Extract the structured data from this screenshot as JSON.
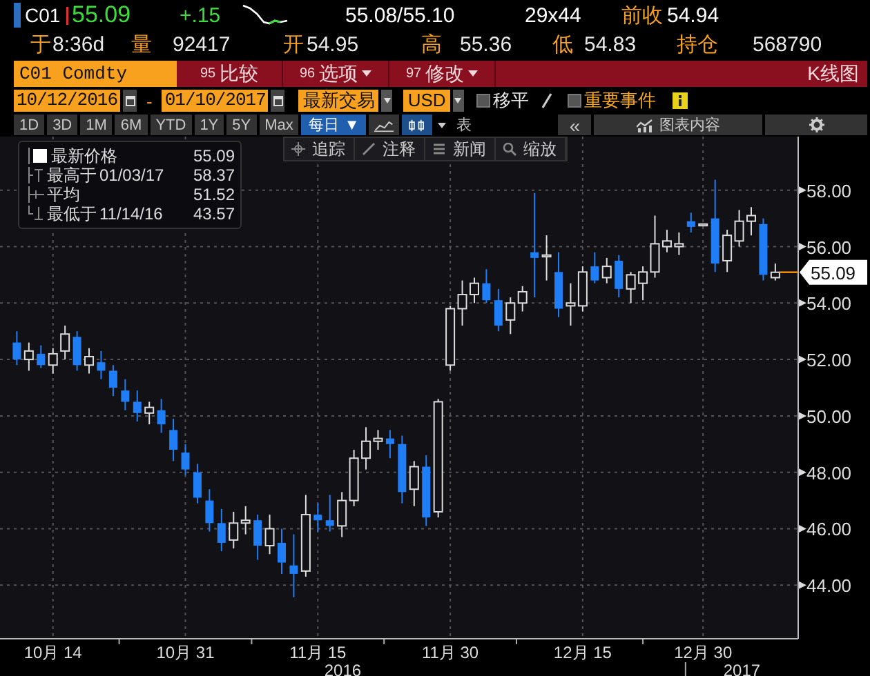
{
  "quote": {
    "ticker": "C01",
    "last": "55.09",
    "change": "+.15",
    "bid_ask": "55.08/55.10",
    "size": "29x44",
    "prev_close": {
      "label": "前收",
      "value": "54.94"
    },
    "stats": [
      {
        "label": "于",
        "value": "8:36d"
      },
      {
        "label": "量",
        "value": "92417"
      },
      {
        "label": "开",
        "value": "54.95"
      },
      {
        "label": "高",
        "value": "55.36"
      },
      {
        "label": "低",
        "value": "54.83"
      },
      {
        "label": "持仓",
        "value": "568790"
      }
    ]
  },
  "command_bar": {
    "security": "C01 Comdty",
    "menus": [
      {
        "number": "95",
        "label": "比较",
        "dropdown": false
      },
      {
        "number": "96",
        "label": "选项",
        "dropdown": true
      },
      {
        "number": "97",
        "label": "修改",
        "dropdown": true
      }
    ],
    "title": "K线图"
  },
  "range_bar": {
    "start_date": "10/12/2016",
    "separator": "-",
    "end_date": "01/10/2017",
    "price_source": "最新交易",
    "currency": "USD",
    "checkboxes": [
      {
        "label": "移平",
        "checked": false,
        "color": "#e8e8e8"
      },
      {
        "label": "重要事件",
        "checked": false,
        "color": "#f5a623"
      }
    ]
  },
  "tool_bar": {
    "periods": [
      {
        "label": "1D",
        "selected": false
      },
      {
        "label": "3D",
        "selected": false
      },
      {
        "label": "1M",
        "selected": false
      },
      {
        "label": "6M",
        "selected": false
      },
      {
        "label": "YTD",
        "selected": false
      },
      {
        "label": "1Y",
        "selected": false
      },
      {
        "label": "5Y",
        "selected": false
      },
      {
        "label": "Max",
        "selected": false
      }
    ],
    "frequency": "每日",
    "frequency_mark": "▼",
    "chart_types": [
      {
        "kind": "line",
        "selected": false
      },
      {
        "kind": "candle",
        "selected": true
      }
    ],
    "table_label": "表",
    "collapse": "«",
    "contents_label": "图表内容"
  },
  "chart": {
    "tools": [
      {
        "kind": "crosshair",
        "label": "追踪"
      },
      {
        "kind": "pencil",
        "label": "注释"
      },
      {
        "kind": "news",
        "label": "新闻"
      },
      {
        "kind": "zoom",
        "label": "缩放"
      }
    ],
    "legend": [
      {
        "kind": "last",
        "label": "最新价格",
        "value": "55.09"
      },
      {
        "kind": "high",
        "label": "最高于",
        "date": "01/03/17",
        "value": "58.37"
      },
      {
        "kind": "average",
        "label": "平均",
        "value": "51.52"
      },
      {
        "kind": "low",
        "label": "最低于",
        "date": "11/14/16",
        "value": "43.57"
      }
    ],
    "last_price_tag": "55.09",
    "year_labels": [
      "2016",
      "2017"
    ],
    "chart_data": {
      "type": "candlestick",
      "grid": true,
      "ylim": [
        42.1,
        59.9
      ],
      "yticks": [
        {
          "value": 44,
          "label": "44.00"
        },
        {
          "value": 46,
          "label": "46.00"
        },
        {
          "value": 48,
          "label": "48.00"
        },
        {
          "value": 50,
          "label": "50.00"
        },
        {
          "value": 52,
          "label": "52.00"
        },
        {
          "value": 54,
          "label": "54.00"
        },
        {
          "value": 56,
          "label": "56.00"
        },
        {
          "value": 58,
          "label": "58.00"
        }
      ],
      "categories": [
        null,
        null,
        null,
        "10月 14",
        null,
        null,
        null,
        null,
        null,
        null,
        null,
        null,
        null,
        null,
        "10月 31",
        null,
        null,
        null,
        null,
        null,
        null,
        null,
        null,
        null,
        null,
        "11月 15",
        null,
        null,
        null,
        null,
        null,
        null,
        null,
        null,
        null,
        null,
        "11月 30",
        null,
        null,
        null,
        null,
        null,
        null,
        null,
        null,
        null,
        null,
        "12月 15",
        null,
        null,
        null,
        null,
        null,
        null,
        null,
        null,
        null,
        "12月 30",
        null,
        null,
        null,
        null,
        null,
        null
      ],
      "ohlc": [
        [
          52.6,
          53.0,
          51.8,
          52.0
        ],
        [
          52.0,
          52.6,
          51.6,
          52.3
        ],
        [
          52.2,
          52.5,
          51.7,
          51.8
        ],
        [
          51.8,
          52.4,
          51.5,
          52.2
        ],
        [
          52.3,
          53.2,
          52.0,
          52.9
        ],
        [
          52.8,
          53.0,
          51.6,
          51.8
        ],
        [
          51.8,
          52.4,
          51.5,
          52.1
        ],
        [
          51.9,
          52.3,
          51.3,
          51.6
        ],
        [
          51.6,
          51.8,
          50.7,
          51.0
        ],
        [
          50.9,
          51.3,
          50.2,
          50.5
        ],
        [
          50.5,
          50.9,
          49.8,
          50.1
        ],
        [
          50.1,
          50.5,
          49.7,
          50.3
        ],
        [
          50.2,
          50.6,
          49.4,
          49.7
        ],
        [
          49.5,
          49.9,
          48.4,
          48.8
        ],
        [
          48.7,
          49.0,
          47.9,
          48.1
        ],
        [
          48.0,
          48.3,
          46.9,
          47.1
        ],
        [
          47.0,
          47.4,
          45.9,
          46.2
        ],
        [
          46.2,
          46.7,
          45.2,
          45.5
        ],
        [
          45.6,
          46.6,
          45.3,
          46.2
        ],
        [
          46.2,
          46.8,
          45.8,
          46.3
        ],
        [
          46.3,
          46.5,
          44.9,
          45.4
        ],
        [
          45.4,
          46.5,
          45.1,
          46.0
        ],
        [
          45.5,
          46.0,
          44.4,
          44.8
        ],
        [
          44.7,
          45.8,
          43.57,
          44.4
        ],
        [
          44.5,
          47.2,
          44.3,
          46.5
        ],
        [
          46.5,
          46.9,
          45.9,
          46.3
        ],
        [
          46.3,
          47.2,
          45.9,
          46.1
        ],
        [
          46.1,
          47.3,
          45.7,
          47.0
        ],
        [
          47.0,
          48.8,
          46.8,
          48.5
        ],
        [
          48.5,
          49.6,
          48.1,
          49.1
        ],
        [
          49.1,
          49.5,
          48.8,
          49.2
        ],
        [
          49.2,
          49.5,
          48.5,
          49.0
        ],
        [
          49.0,
          49.3,
          46.9,
          47.3
        ],
        [
          47.4,
          48.4,
          46.8,
          48.2
        ],
        [
          48.2,
          48.6,
          46.1,
          46.4
        ],
        [
          46.6,
          50.6,
          46.4,
          50.5
        ],
        [
          51.8,
          53.9,
          51.6,
          53.8
        ],
        [
          53.8,
          54.8,
          53.2,
          54.3
        ],
        [
          54.3,
          54.9,
          54.0,
          54.7
        ],
        [
          54.7,
          55.2,
          54.0,
          54.1
        ],
        [
          54.1,
          54.5,
          53.0,
          53.2
        ],
        [
          53.4,
          54.2,
          52.9,
          54.0
        ],
        [
          54.0,
          54.6,
          53.7,
          54.4
        ],
        [
          55.8,
          57.9,
          54.2,
          55.6
        ],
        [
          55.7,
          56.4,
          54.8,
          55.7
        ],
        [
          55.1,
          55.8,
          53.5,
          53.8
        ],
        [
          53.9,
          54.7,
          53.2,
          54.0
        ],
        [
          53.9,
          55.3,
          53.7,
          55.1
        ],
        [
          55.3,
          55.8,
          54.7,
          54.8
        ],
        [
          54.9,
          55.6,
          54.7,
          55.3
        ],
        [
          55.5,
          55.7,
          54.2,
          54.5
        ],
        [
          54.5,
          55.1,
          54.0,
          55.0
        ],
        [
          54.7,
          55.3,
          54.1,
          55.1
        ],
        [
          55.1,
          57.1,
          54.9,
          56.1
        ],
        [
          56.0,
          56.6,
          55.8,
          56.2
        ],
        [
          56.0,
          56.5,
          55.7,
          56.1
        ],
        [
          56.9,
          57.2,
          56.5,
          56.7
        ],
        [
          56.8,
          56.8,
          56.8,
          56.8
        ],
        [
          57.0,
          58.37,
          55.1,
          55.4
        ],
        [
          55.5,
          56.6,
          55.1,
          56.4
        ],
        [
          56.2,
          57.3,
          56.0,
          56.9
        ],
        [
          56.9,
          57.4,
          56.4,
          57.1
        ],
        [
          56.8,
          57.0,
          54.8,
          55.0
        ],
        [
          54.9,
          55.4,
          54.8,
          55.09
        ]
      ]
    }
  }
}
